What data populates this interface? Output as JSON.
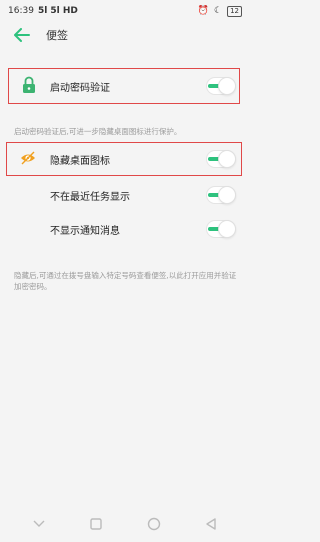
{
  "status_bar": {
    "time": "16:39",
    "network": "5l 5l HD",
    "battery": "12"
  },
  "header": {
    "title": "便签"
  },
  "settings": {
    "password_verify": {
      "label": "启动密码验证",
      "enabled": true
    },
    "password_note": "启动密码验证后,可进一步隐藏桌面图标进行保护。",
    "hide_icon": {
      "label": "隐藏桌面图标",
      "enabled": true
    },
    "hide_recent": {
      "label": "不在最近任务显示",
      "enabled": true
    },
    "hide_notifications": {
      "label": "不显示通知消息",
      "enabled": true
    },
    "hide_note": "隐藏后,可通过在拨号盘输入特定号码查看便签,以此打开应用并验证加密密码。"
  },
  "colors": {
    "accent": "#2ec27e",
    "highlight": "#e04848",
    "lock_icon": "#3cb371",
    "eye_icon": "#f0a020"
  }
}
